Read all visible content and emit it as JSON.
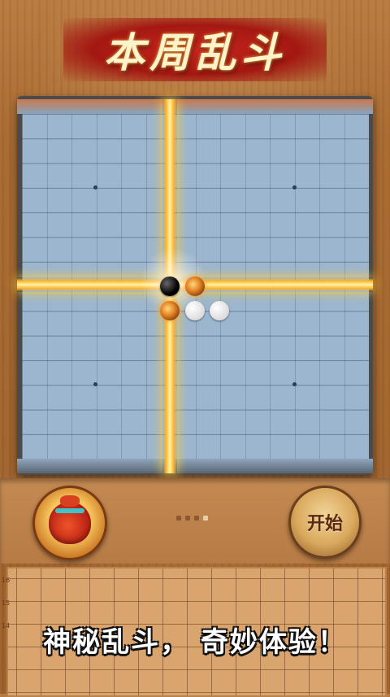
{
  "game": {
    "title": "本周乱斗",
    "caption": "神秘乱斗， 奇妙体验！",
    "start_label": "开始",
    "board_row_numbers": [
      "16",
      "15",
      "14"
    ]
  },
  "pager": {
    "total_pages": 4,
    "active_page": 4
  },
  "colors": {
    "board": "#9db6cf",
    "beam": "#ffb52a",
    "title_banner": "#c8251e",
    "wood": "#b97a3f"
  },
  "icons": {
    "bag": "lucky-bag-icon",
    "start": "start-button"
  }
}
